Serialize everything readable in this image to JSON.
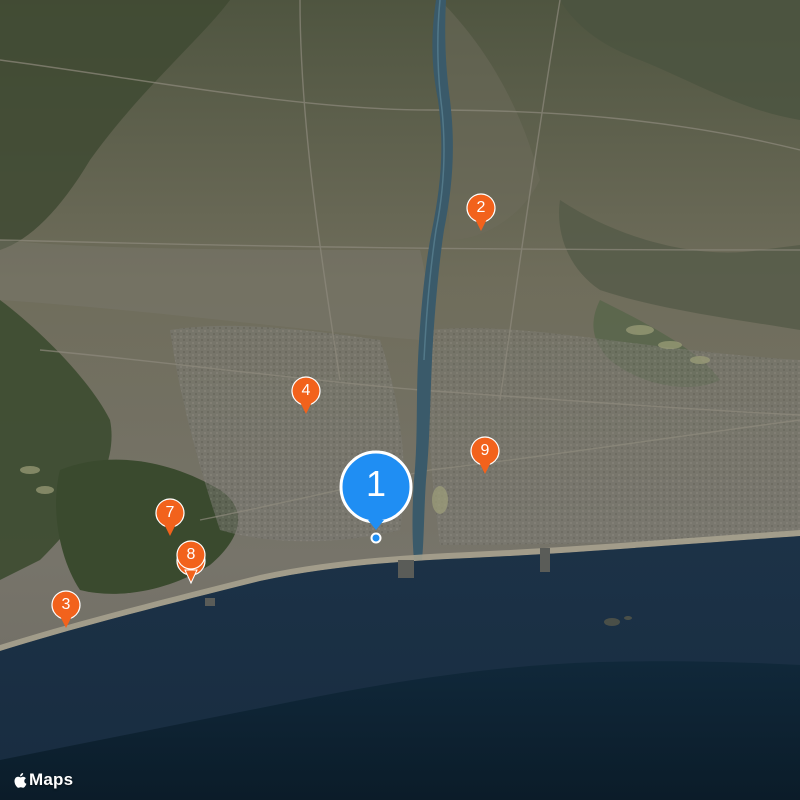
{
  "map": {
    "style": "satellite",
    "colors": {
      "pin_orange": "#f2621c",
      "pin_blue": "#1f8ef3",
      "ocean": "#1a3550",
      "ocean_deep": "#0d2131",
      "land": "#6f6b58"
    }
  },
  "markers": [
    {
      "id": "1",
      "label": "1",
      "selected": true
    },
    {
      "id": "2",
      "label": "2",
      "selected": false
    },
    {
      "id": "3",
      "label": "3",
      "selected": false
    },
    {
      "id": "4",
      "label": "4",
      "selected": false
    },
    {
      "id": "7",
      "label": "7",
      "selected": false
    },
    {
      "id": "8",
      "label": "8",
      "selected": false
    },
    {
      "id": "9",
      "label": "9",
      "selected": false
    }
  ],
  "attribution": {
    "logo_icon": "apple-logo-icon",
    "text": "Maps"
  }
}
